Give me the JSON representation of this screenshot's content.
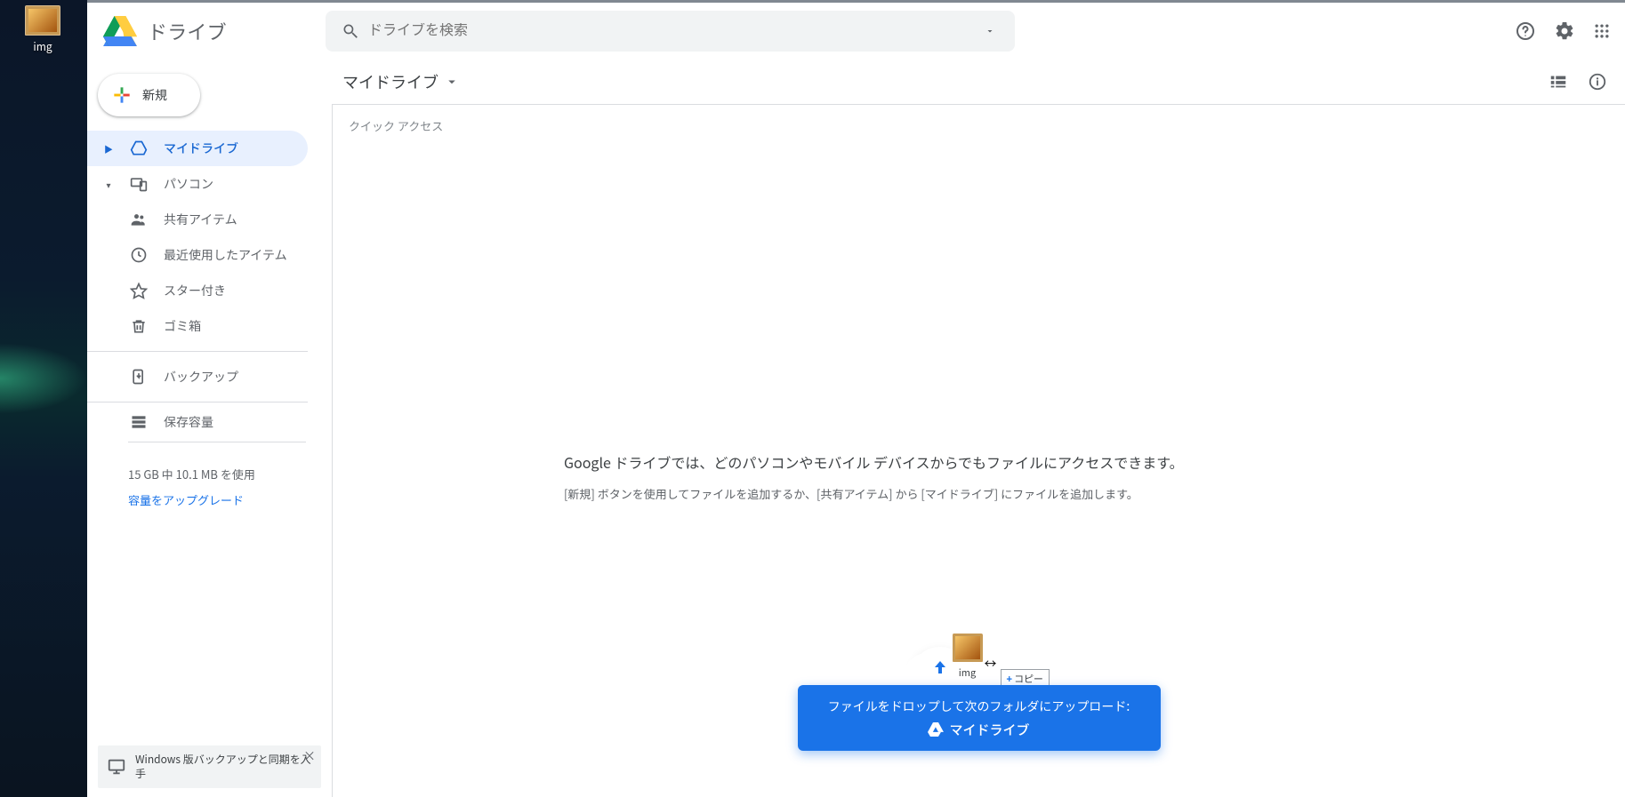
{
  "desktop": {
    "icon_label": "img"
  },
  "brand": {
    "label": "ドライブ"
  },
  "search": {
    "placeholder": "ドライブを検索"
  },
  "new_button": {
    "label": "新規"
  },
  "sidebar": {
    "items": [
      {
        "label": "マイドライブ"
      },
      {
        "label": "パソコン"
      },
      {
        "label": "共有アイテム"
      },
      {
        "label": "最近使用したアイテム"
      },
      {
        "label": "スター付き"
      },
      {
        "label": "ゴミ箱"
      }
    ],
    "backup_label": "バックアップ",
    "storage_label": "保存容量",
    "storage_usage": "15 GB 中 10.1 MB を使用",
    "storage_upgrade": "容量をアップグレード"
  },
  "toolbar": {
    "breadcrumb": "マイドライブ"
  },
  "content": {
    "quick_access_label": "クイック アクセス",
    "empty_title": "Google ドライブでは、どのパソコンやモバイル デバイスからでもファイルにアクセスできます。",
    "empty_sub": "[新規] ボタンを使用してファイルを追加するか、[共有アイテム] から [マイドライブ] にファイルを追加します。"
  },
  "drop_banner": {
    "line1": "ファイルをドロップして次のフォルダにアップロード:",
    "line2": "マイドライブ"
  },
  "drag": {
    "folder_label": "img",
    "copy_label": "コピー"
  },
  "sync_banner": {
    "text": "Windows 版バックアップと同期を入手"
  }
}
